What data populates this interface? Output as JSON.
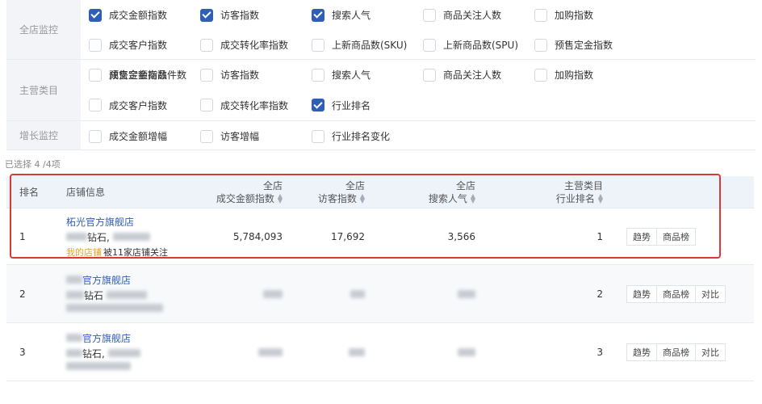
{
  "filters": [
    {
      "category": "全店监控",
      "options": [
        {
          "label": "成交金额指数",
          "checked": true
        },
        {
          "label": "访客指数",
          "checked": true
        },
        {
          "label": "搜索人气",
          "checked": true
        },
        {
          "label": "商品关注人数",
          "checked": false
        },
        {
          "label": "加购指数",
          "checked": false
        },
        {
          "label": "成交客户指数",
          "checked": false
        },
        {
          "label": "成交转化率指数",
          "checked": false
        },
        {
          "label": "上新商品数(SKU)",
          "checked": false
        },
        {
          "label": "上新商品数(SPU)",
          "checked": false
        },
        {
          "label": "预售定金指数",
          "checked": false
        },
        {
          "label": "预售定金商品件数",
          "checked": false
        }
      ]
    },
    {
      "category": "主营类目",
      "options": [
        {
          "label": "成交金额指数",
          "checked": false
        },
        {
          "label": "访客指数",
          "checked": false
        },
        {
          "label": "搜索人气",
          "checked": false
        },
        {
          "label": "商品关注人数",
          "checked": false
        },
        {
          "label": "加购指数",
          "checked": false
        },
        {
          "label": "成交客户指数",
          "checked": false
        },
        {
          "label": "成交转化率指数",
          "checked": false
        },
        {
          "label": "行业排名",
          "checked": true
        }
      ]
    },
    {
      "category": "增长监控",
      "options": [
        {
          "label": "成交金额增幅",
          "checked": false
        },
        {
          "label": "访客增幅",
          "checked": false
        },
        {
          "label": "行业排名变化",
          "checked": false
        }
      ]
    }
  ],
  "selected_count": "已选择 4 /4项",
  "table": {
    "headers": {
      "rank": "排名",
      "shop": "店铺信息",
      "col1_top": "全店",
      "col1_bottom": "成交金额指数",
      "col2_top": "全店",
      "col2_bottom": "访客指数",
      "col3_top": "全店",
      "col3_bottom": "搜索人气",
      "col4_top": "主营类目",
      "col4_bottom": "行业排名"
    },
    "rows": [
      {
        "rank": "1",
        "shop_name": "柘光官方旗舰店",
        "shop_level": "钻石,",
        "my_tag": "我的店铺",
        "follow": "被11家店铺关注",
        "v1": "5,784,093",
        "v2": "17,692",
        "v3": "3,566",
        "v4": "1",
        "actions": [
          "趋势",
          "商品榜"
        ]
      },
      {
        "rank": "2",
        "shop_name": "官方旗舰店",
        "shop_level": "钻石",
        "my_tag": "",
        "follow": "",
        "v1": "",
        "v2": "",
        "v3": "",
        "v4": "2",
        "actions": [
          "趋势",
          "商品榜",
          "对比"
        ]
      },
      {
        "rank": "3",
        "shop_name": "官方旗舰店",
        "shop_level": "钻石,",
        "my_tag": "",
        "follow": "",
        "v1": "",
        "v2": "",
        "v3": "",
        "v4": "3",
        "actions": [
          "趋势",
          "商品榜",
          "对比"
        ]
      }
    ]
  },
  "colors": {
    "accent": "#2f5fb5",
    "highlight": "#d93a34",
    "my_tag": "#e0a23a"
  }
}
